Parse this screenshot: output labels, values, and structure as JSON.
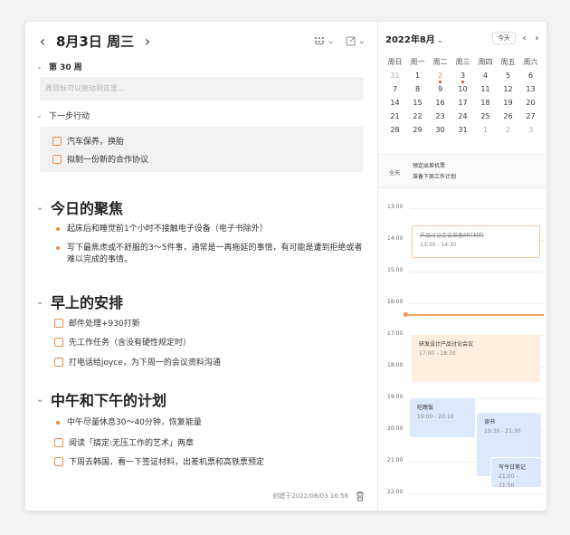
{
  "header": {
    "prev": "‹",
    "title": "8月3日 周三",
    "next": "›"
  },
  "week_section": {
    "label": "第 30 周",
    "placeholder": "周目标可以拖动到这里..."
  },
  "next_actions": {
    "label": "下一步行动",
    "items": [
      "汽车保养，换胎",
      "拟制一份新的合作协议"
    ]
  },
  "focus": {
    "title": "今日的聚焦",
    "bullets": [
      "起床后和睡觉前1个小时不接触电子设备（电子书除外）",
      "写下最焦虑或不舒服的3～5件事，通常是一再拖延的事情，有可能是遭到拒绝或者难以完成的事情。"
    ]
  },
  "morning": {
    "title": "早上的安排",
    "tasks": [
      "邮件处理+930打新",
      "先工作任务（含没有硬性规定时）",
      "打电话给joyce，为下周一的会议资料沟通"
    ]
  },
  "afternoon": {
    "title": "中午和下午的计划",
    "bullets": [
      "中午尽量休息30～40分钟，恢复能量"
    ],
    "tasks": [
      "阅读「搞定:无压工作的艺术」两章",
      "下周去韩国，看一下签证材料，出差机票和高铁票预定"
    ]
  },
  "footer": {
    "created": "创建于2022/08/03 16:58"
  },
  "calendar": {
    "title": "2022年8月",
    "today_label": "今天",
    "weekdays": [
      "周日",
      "周一",
      "周二",
      "周三",
      "周四",
      "周五",
      "周六"
    ],
    "weeks": [
      [
        "31",
        "1",
        "2",
        "3",
        "4",
        "5",
        "6"
      ],
      [
        "7",
        "8",
        "9",
        "10",
        "11",
        "12",
        "13"
      ],
      [
        "14",
        "15",
        "16",
        "17",
        "18",
        "19",
        "20"
      ],
      [
        "21",
        "22",
        "23",
        "24",
        "25",
        "26",
        "27"
      ],
      [
        "28",
        "29",
        "30",
        "31",
        "1",
        "2",
        "3"
      ]
    ],
    "allday_label": "全天",
    "allday_events": [
      "预定出差机票",
      "准备下周工作计划"
    ],
    "hours": [
      "13:00",
      "14:00",
      "15:00",
      "16:00",
      "17:00",
      "18:00",
      "19:00",
      "20:00",
      "21:00",
      "22:00"
    ],
    "events": [
      {
        "title": "产品讨论会议准备PPT材料",
        "time": "13:30 - 14:30"
      },
      {
        "title": "研发设计产品讨论会议",
        "time": "17:00 - 18:30"
      },
      {
        "title": "吃晚饭",
        "time": "19:00 - 20:10"
      },
      {
        "title": "读书",
        "time": "19:30 - 21:30"
      },
      {
        "title": "写今日笔记",
        "time": "21:00 - 21:50"
      }
    ],
    "colors": {
      "accent": "#f08a3c",
      "event_orange": "#fdeedd",
      "event_blue": "#dce8fb"
    }
  }
}
